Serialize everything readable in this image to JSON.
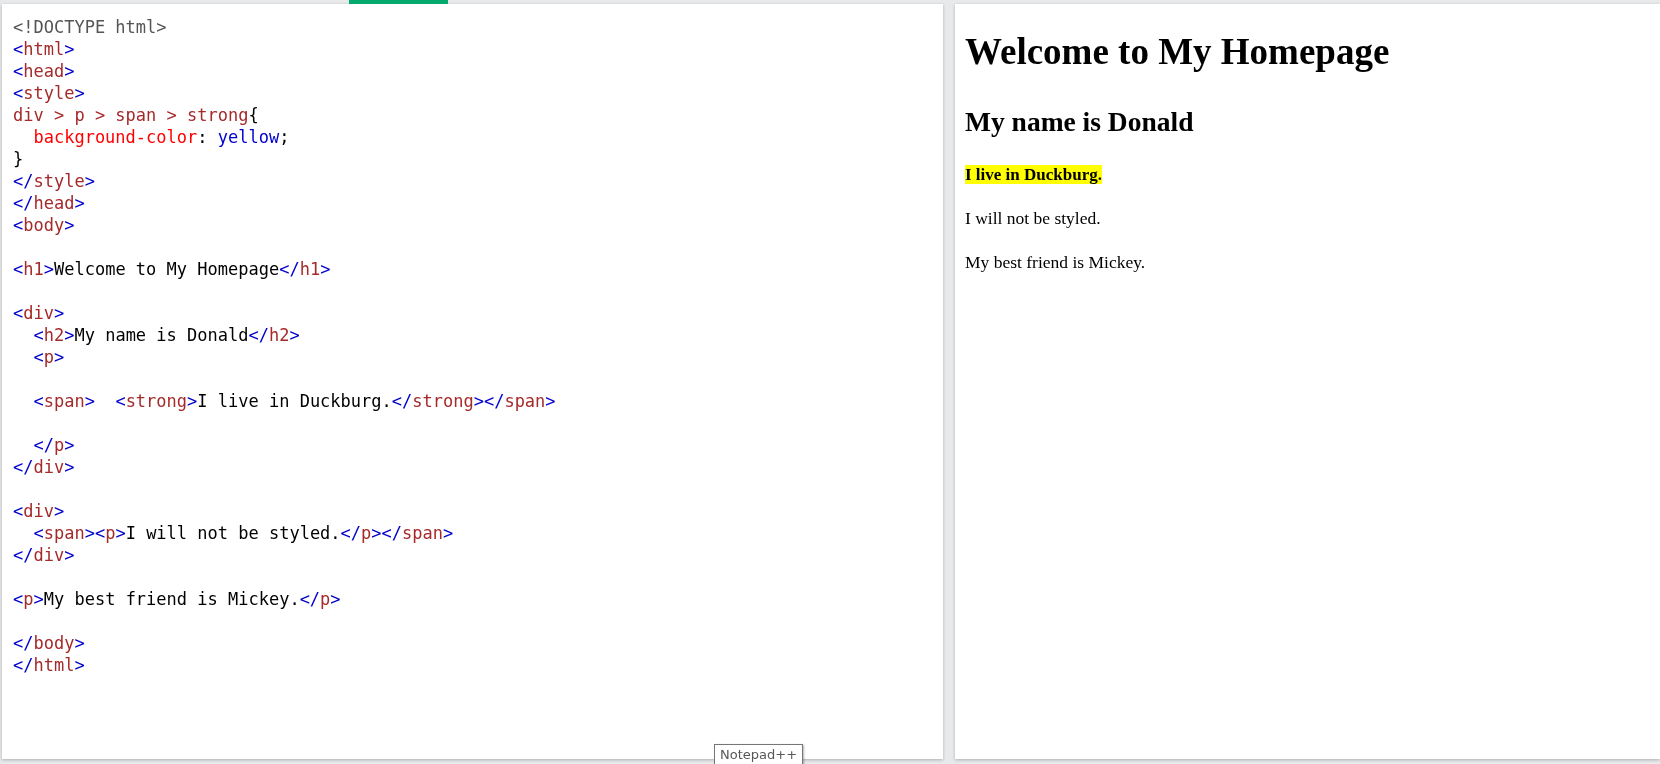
{
  "editor": {
    "lines": [
      {
        "kind": "code",
        "tokens": [
          {
            "kind": "doctype",
            "text": "<!DOCTYPE html>"
          }
        ]
      },
      {
        "kind": "code",
        "tokens": [
          {
            "kind": "punct",
            "text": "<"
          },
          {
            "kind": "tag",
            "text": "html"
          },
          {
            "kind": "punct",
            "text": ">"
          }
        ]
      },
      {
        "kind": "code",
        "tokens": [
          {
            "kind": "punct",
            "text": "<"
          },
          {
            "kind": "tag",
            "text": "head"
          },
          {
            "kind": "punct",
            "text": ">"
          }
        ]
      },
      {
        "kind": "code",
        "tokens": [
          {
            "kind": "punct",
            "text": "<"
          },
          {
            "kind": "tag",
            "text": "style"
          },
          {
            "kind": "punct",
            "text": ">"
          }
        ]
      },
      {
        "kind": "code",
        "tokens": [
          {
            "kind": "tag",
            "text": "div > p > span > strong"
          },
          {
            "kind": "text",
            "text": "{"
          }
        ]
      },
      {
        "kind": "code",
        "indent": true,
        "tokens": [
          {
            "kind": "prop",
            "text": "background-color"
          },
          {
            "kind": "text",
            "text": ": "
          },
          {
            "kind": "value",
            "text": "yellow"
          },
          {
            "kind": "text",
            "text": ";"
          }
        ]
      },
      {
        "kind": "code",
        "tokens": [
          {
            "kind": "text",
            "text": "}"
          }
        ]
      },
      {
        "kind": "code",
        "tokens": [
          {
            "kind": "punct",
            "text": "</"
          },
          {
            "kind": "tag",
            "text": "style"
          },
          {
            "kind": "punct",
            "text": ">"
          }
        ]
      },
      {
        "kind": "code",
        "tokens": [
          {
            "kind": "punct",
            "text": "</"
          },
          {
            "kind": "tag",
            "text": "head"
          },
          {
            "kind": "punct",
            "text": ">"
          }
        ]
      },
      {
        "kind": "code",
        "tokens": [
          {
            "kind": "punct",
            "text": "<"
          },
          {
            "kind": "tag",
            "text": "body"
          },
          {
            "kind": "punct",
            "text": ">"
          }
        ]
      },
      {
        "kind": "blank"
      },
      {
        "kind": "code",
        "tokens": [
          {
            "kind": "punct",
            "text": "<"
          },
          {
            "kind": "tag",
            "text": "h1"
          },
          {
            "kind": "punct",
            "text": ">"
          },
          {
            "kind": "text",
            "text": "Welcome to My Homepage"
          },
          {
            "kind": "punct",
            "text": "</"
          },
          {
            "kind": "tag",
            "text": "h1"
          },
          {
            "kind": "punct",
            "text": ">"
          }
        ]
      },
      {
        "kind": "blank"
      },
      {
        "kind": "code",
        "tokens": [
          {
            "kind": "punct",
            "text": "<"
          },
          {
            "kind": "tag",
            "text": "div"
          },
          {
            "kind": "punct",
            "text": ">"
          }
        ]
      },
      {
        "kind": "code",
        "indent": true,
        "tokens": [
          {
            "kind": "punct",
            "text": "<"
          },
          {
            "kind": "tag",
            "text": "h2"
          },
          {
            "kind": "punct",
            "text": ">"
          },
          {
            "kind": "text",
            "text": "My name is Donald"
          },
          {
            "kind": "punct",
            "text": "</"
          },
          {
            "kind": "tag",
            "text": "h2"
          },
          {
            "kind": "punct",
            "text": ">"
          }
        ]
      },
      {
        "kind": "code",
        "indent": true,
        "tokens": [
          {
            "kind": "punct",
            "text": "<"
          },
          {
            "kind": "tag",
            "text": "p"
          },
          {
            "kind": "punct",
            "text": ">"
          }
        ]
      },
      {
        "kind": "blank"
      },
      {
        "kind": "code",
        "indent": true,
        "tokens": [
          {
            "kind": "punct",
            "text": "<"
          },
          {
            "kind": "tag",
            "text": "span"
          },
          {
            "kind": "punct",
            "text": ">  <"
          },
          {
            "kind": "tag",
            "text": "strong"
          },
          {
            "kind": "punct",
            "text": ">"
          },
          {
            "kind": "text",
            "text": "I live in Duckburg."
          },
          {
            "kind": "punct",
            "text": "</"
          },
          {
            "kind": "tag",
            "text": "strong"
          },
          {
            "kind": "punct",
            "text": "></"
          },
          {
            "kind": "tag",
            "text": "span"
          },
          {
            "kind": "punct",
            "text": ">"
          }
        ]
      },
      {
        "kind": "blank"
      },
      {
        "kind": "code",
        "indent": true,
        "tokens": [
          {
            "kind": "punct",
            "text": "</"
          },
          {
            "kind": "tag",
            "text": "p"
          },
          {
            "kind": "punct",
            "text": ">"
          }
        ]
      },
      {
        "kind": "code",
        "tokens": [
          {
            "kind": "punct",
            "text": "</"
          },
          {
            "kind": "tag",
            "text": "div"
          },
          {
            "kind": "punct",
            "text": ">"
          }
        ]
      },
      {
        "kind": "blank"
      },
      {
        "kind": "code",
        "tokens": [
          {
            "kind": "punct",
            "text": "<"
          },
          {
            "kind": "tag",
            "text": "div"
          },
          {
            "kind": "punct",
            "text": ">"
          }
        ]
      },
      {
        "kind": "code",
        "indent": true,
        "tokens": [
          {
            "kind": "punct",
            "text": "<"
          },
          {
            "kind": "tag",
            "text": "span"
          },
          {
            "kind": "punct",
            "text": "><"
          },
          {
            "kind": "tag",
            "text": "p"
          },
          {
            "kind": "punct",
            "text": ">"
          },
          {
            "kind": "text",
            "text": "I will not be styled."
          },
          {
            "kind": "punct",
            "text": "</"
          },
          {
            "kind": "tag",
            "text": "p"
          },
          {
            "kind": "punct",
            "text": "></"
          },
          {
            "kind": "tag",
            "text": "span"
          },
          {
            "kind": "punct",
            "text": ">"
          }
        ]
      },
      {
        "kind": "code",
        "tokens": [
          {
            "kind": "punct",
            "text": "</"
          },
          {
            "kind": "tag",
            "text": "div"
          },
          {
            "kind": "punct",
            "text": ">"
          }
        ]
      },
      {
        "kind": "blank"
      },
      {
        "kind": "code",
        "tokens": [
          {
            "kind": "punct",
            "text": "<"
          },
          {
            "kind": "tag",
            "text": "p"
          },
          {
            "kind": "punct",
            "text": ">"
          },
          {
            "kind": "text",
            "text": "My best friend is Mickey."
          },
          {
            "kind": "punct",
            "text": "</"
          },
          {
            "kind": "tag",
            "text": "p"
          },
          {
            "kind": "punct",
            "text": ">"
          }
        ]
      },
      {
        "kind": "blank"
      },
      {
        "kind": "code",
        "tokens": [
          {
            "kind": "punct",
            "text": "</"
          },
          {
            "kind": "tag",
            "text": "body"
          },
          {
            "kind": "punct",
            "text": ">"
          }
        ]
      },
      {
        "kind": "code",
        "tokens": [
          {
            "kind": "punct",
            "text": "</"
          },
          {
            "kind": "tag",
            "text": "html"
          },
          {
            "kind": "punct",
            "text": ">"
          }
        ]
      }
    ]
  },
  "preview": {
    "items": [
      {
        "kind": "h1",
        "text": "Welcome to My Homepage"
      },
      {
        "kind": "h2",
        "text": "My name is Donald"
      },
      {
        "kind": "highlight",
        "text": "I live in Duckburg."
      },
      {
        "kind": "p",
        "text": "I will not be styled."
      },
      {
        "kind": "p",
        "text": "My best friend is Mickey."
      }
    ]
  },
  "tooltip": {
    "text": "Notepad++"
  }
}
